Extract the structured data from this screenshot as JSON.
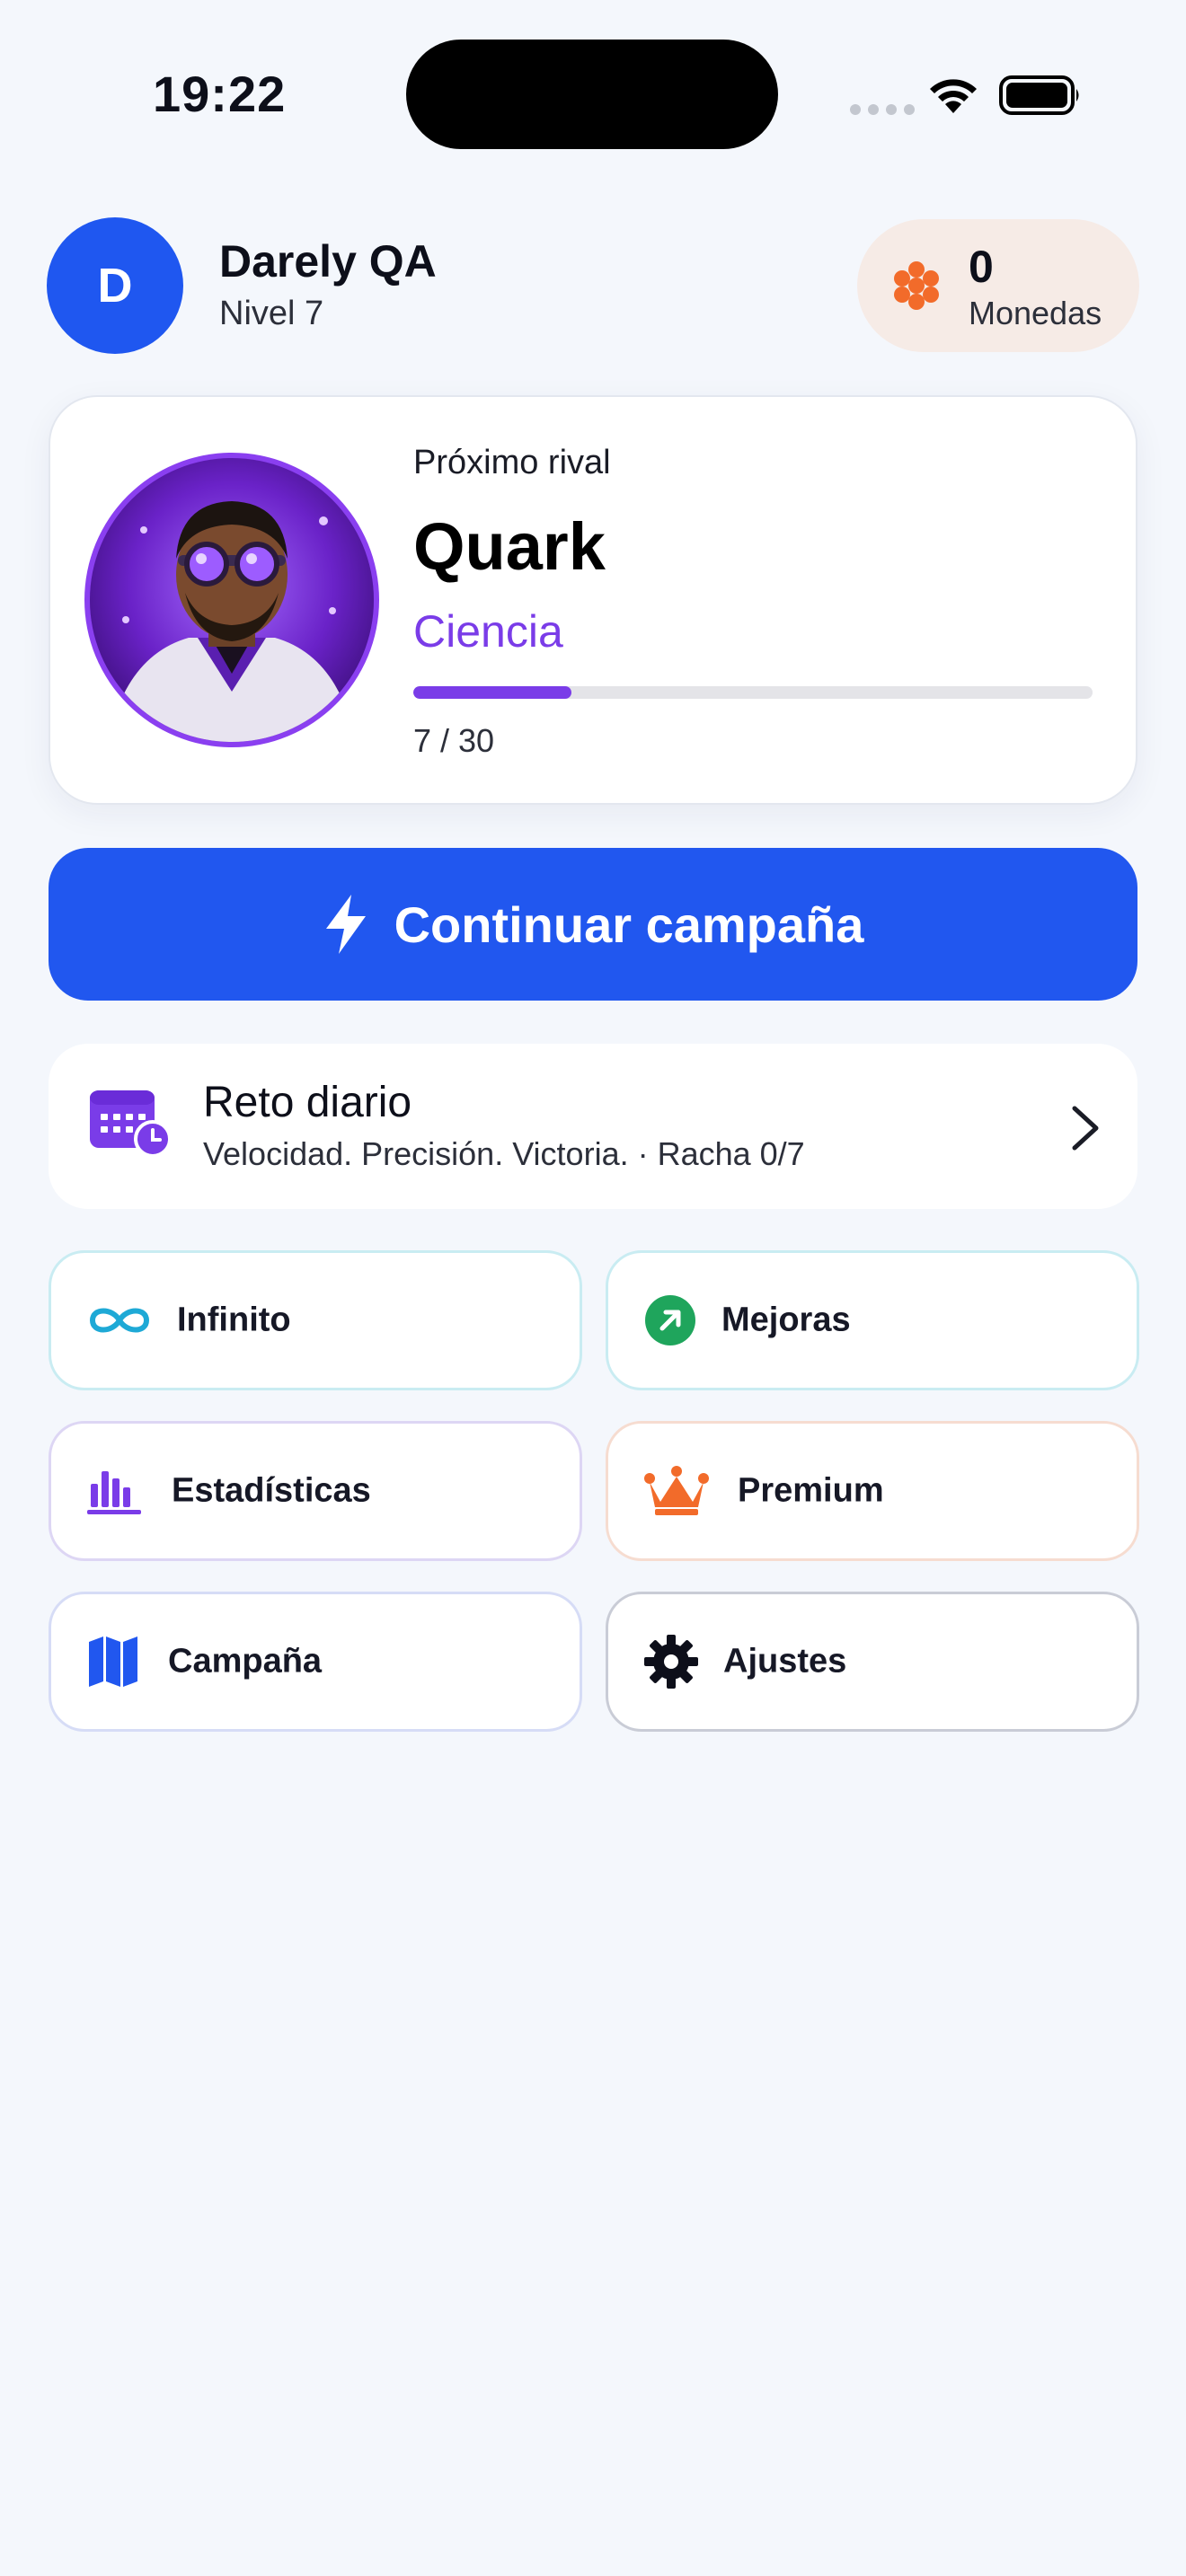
{
  "status_bar": {
    "time": "19:22"
  },
  "profile": {
    "avatar_initial": "D",
    "name": "Darely QA",
    "level": "Nivel 7",
    "coins_value": "0",
    "coins_label": "Monedas"
  },
  "rival": {
    "label": "Próximo rival",
    "name": "Quark",
    "category": "Ciencia",
    "progress_text": "7 / 30",
    "progress_fraction": 0.233
  },
  "actions": {
    "continue_label": "Continuar campaña"
  },
  "daily": {
    "title": "Reto diario",
    "subtitle": "Velocidad. Precisión. Victoria. · Racha 0/7"
  },
  "tiles": {
    "infinito": "Infinito",
    "mejoras": "Mejoras",
    "estadisticas": "Estadísticas",
    "premium": "Premium",
    "campana": "Campaña",
    "ajustes": "Ajustes"
  },
  "colors": {
    "accent_blue": "#2157ef",
    "accent_purple": "#7a3ce8",
    "coins_orange": "#f26b2a",
    "success_green": "#1fa55c"
  },
  "icons": {
    "coins": "coins-icon",
    "bolt": "bolt-icon",
    "calendar": "calendar-icon",
    "infinity": "infinity-icon",
    "arrow_up_right": "arrow-up-right-icon",
    "bar_chart": "bar-chart-icon",
    "crown": "crown-icon",
    "map": "map-icon",
    "gear": "gear-icon"
  }
}
